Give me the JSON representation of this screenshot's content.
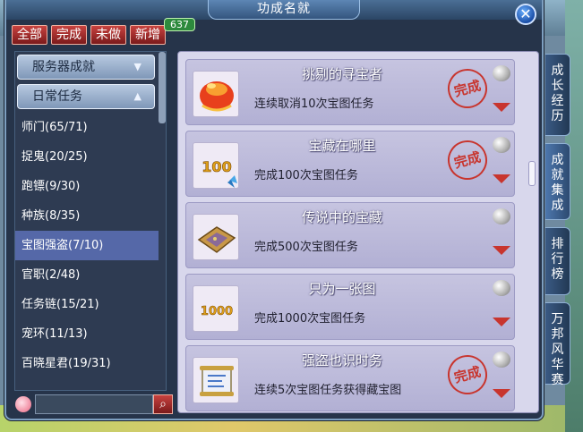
{
  "window": {
    "title": "功成名就"
  },
  "filter_tabs": [
    "全部",
    "完成",
    "未做",
    "新增"
  ],
  "new_count": "637",
  "sidebar": {
    "headers": [
      "服务器成就",
      "日常任务"
    ],
    "items": [
      {
        "label": "师门(65/71)",
        "active": false
      },
      {
        "label": "捉鬼(20/25)",
        "active": false
      },
      {
        "label": "跑镖(9/30)",
        "active": false
      },
      {
        "label": "种族(8/35)",
        "active": false
      },
      {
        "label": "宝图强盗(7/10)",
        "active": true
      },
      {
        "label": "官职(2/48)",
        "active": false
      },
      {
        "label": "任务链(15/21)",
        "active": false
      },
      {
        "label": "宠环(11/13)",
        "active": false
      },
      {
        "label": "百晓星君(19/31)",
        "active": false
      }
    ]
  },
  "search": {
    "placeholder": ""
  },
  "achievements": [
    {
      "name": "挑剔的寻宝者",
      "desc": "连续取消10次宝图任务",
      "completed": true,
      "icon": "red-orb-icon"
    },
    {
      "name": "宝藏在哪里",
      "desc": "完成100次宝图任务",
      "completed": true,
      "icon": "100-badge-icon",
      "icon_text": "100"
    },
    {
      "name": "传说中的宝藏",
      "desc": "完成500次宝图任务",
      "completed": false,
      "icon": "treasure-map-icon"
    },
    {
      "name": "只为一张图",
      "desc": "完成1000次宝图任务",
      "completed": false,
      "icon": "1000-badge-icon",
      "icon_text": "1000"
    },
    {
      "name": "强盗也识时务",
      "desc": "连续5次宝图任务获得藏宝图",
      "completed": true,
      "icon": "scroll-icon"
    }
  ],
  "stamp_text": "完成",
  "right_tabs": [
    "成长经历",
    "成就集成",
    "排行榜",
    "万邦风华赛"
  ],
  "colors": {
    "accent_red": "#c8352e",
    "active_item": "#5568a8"
  }
}
